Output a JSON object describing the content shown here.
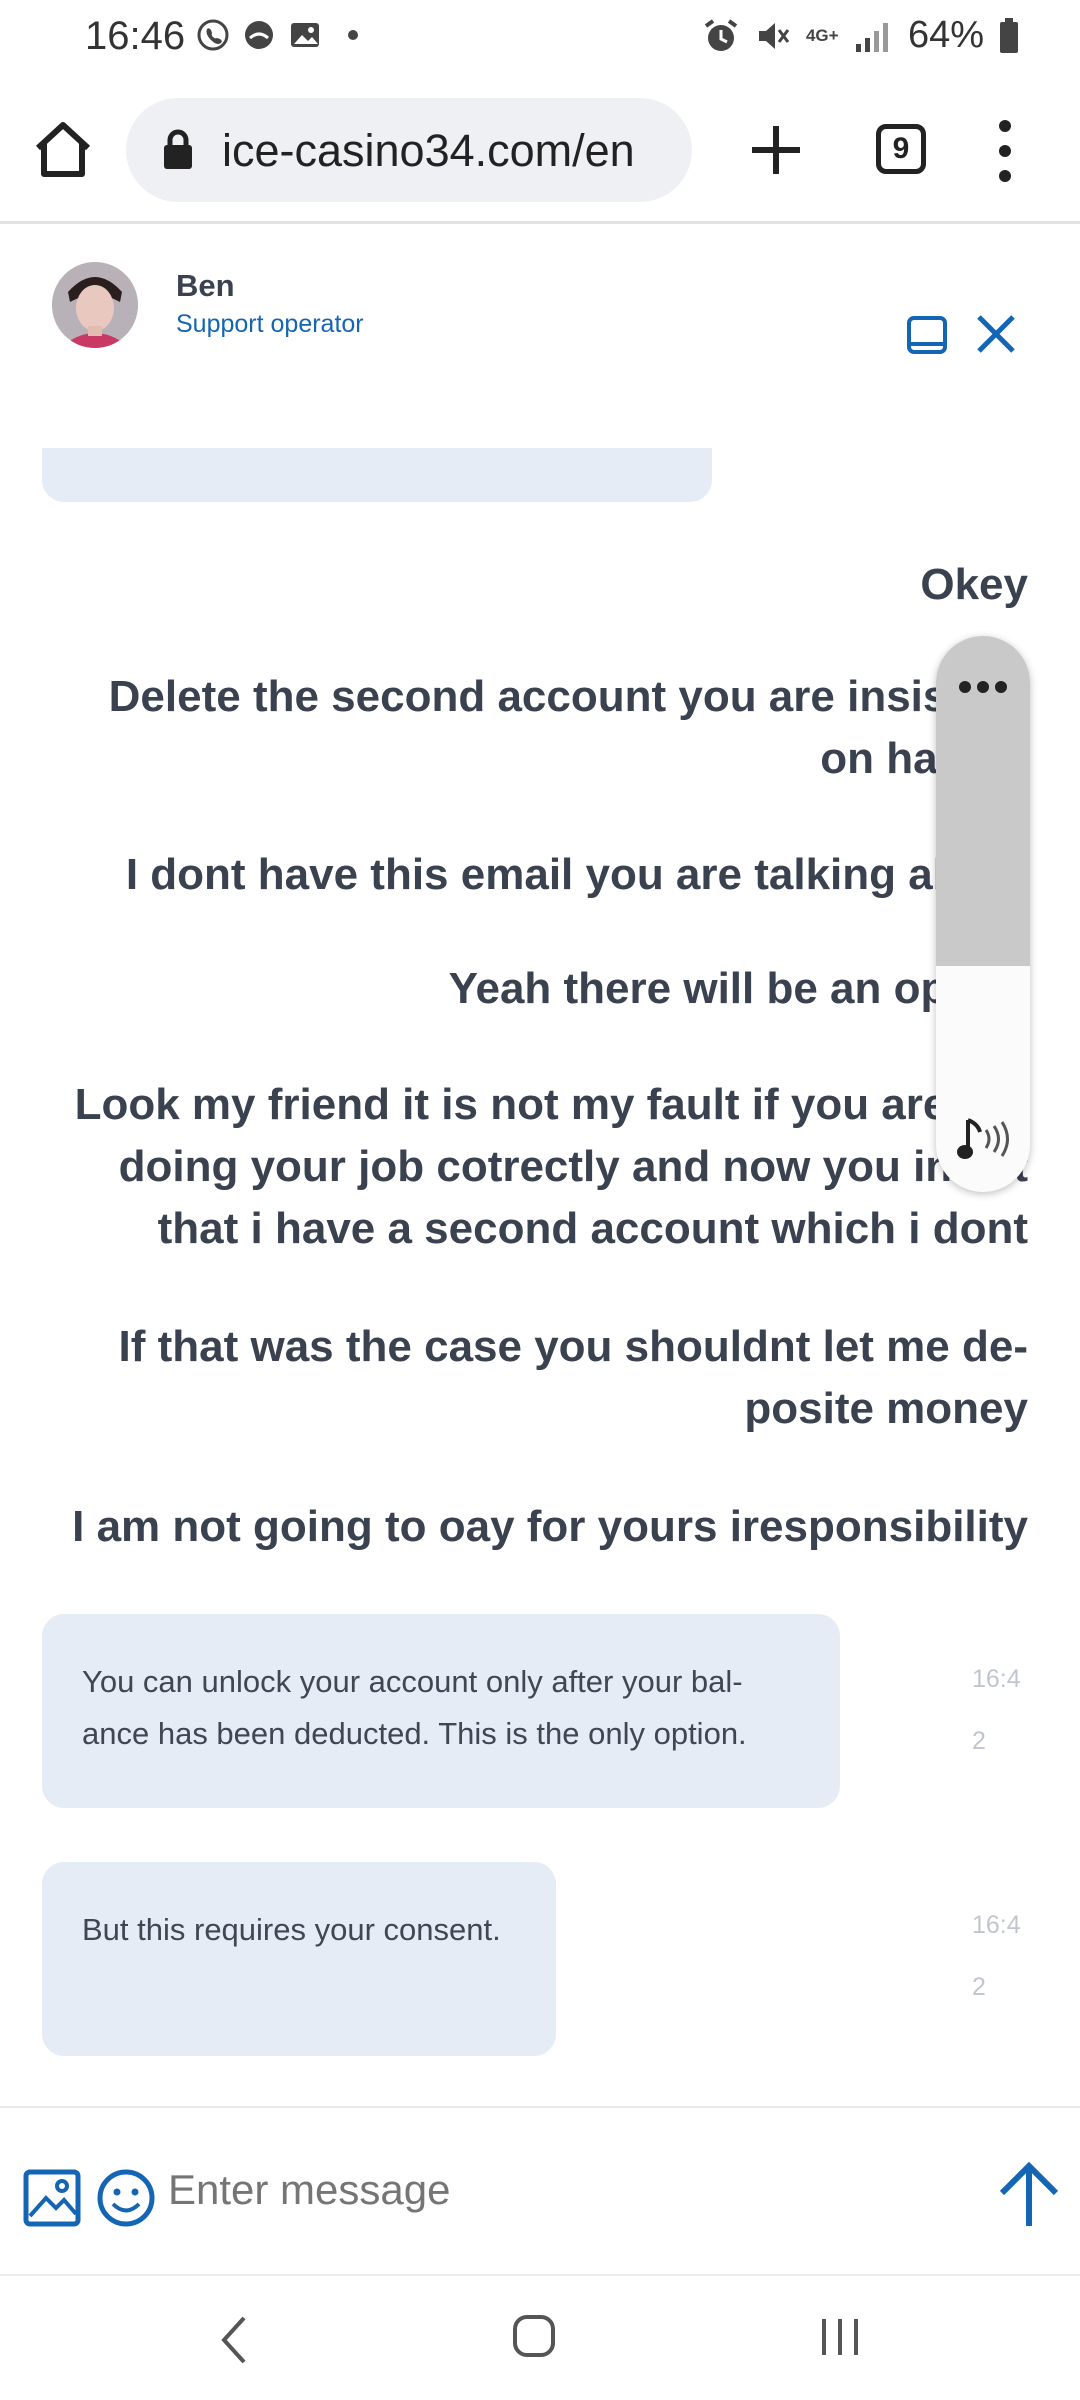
{
  "status_bar": {
    "time": "16:46",
    "network": "4G+",
    "battery": "64%"
  },
  "browser": {
    "url": "ice-casino34.com/en",
    "tab_count": "9"
  },
  "chat": {
    "operator_name": "Ben",
    "operator_role": "Support operator",
    "messages": {
      "m1": "Okey",
      "m2": "Delete the second account you are insisting on having",
      "m3": "I dont have this email you are talking about",
      "m4": "Yeah there will be an option",
      "m5": "Look my friend it is not my fault if you are not doing your job cotrectly and now you insist that i have a second account which i dont",
      "m6": "If that was the case you shouldnt let me de-posite money",
      "m7": "I am not going to oay for yours iresponsibility",
      "op1": "You can unlock your account only after your bal-ance has been deducted. This is the only option.",
      "op1_time": "16:42",
      "op2": "But this requires your consent.",
      "op2_time": "16:42"
    },
    "input_placeholder": "Enter message"
  },
  "colors": {
    "accent": "#1565b5",
    "operator_bubble": "#e6ecf5",
    "text": "#3a4250"
  }
}
